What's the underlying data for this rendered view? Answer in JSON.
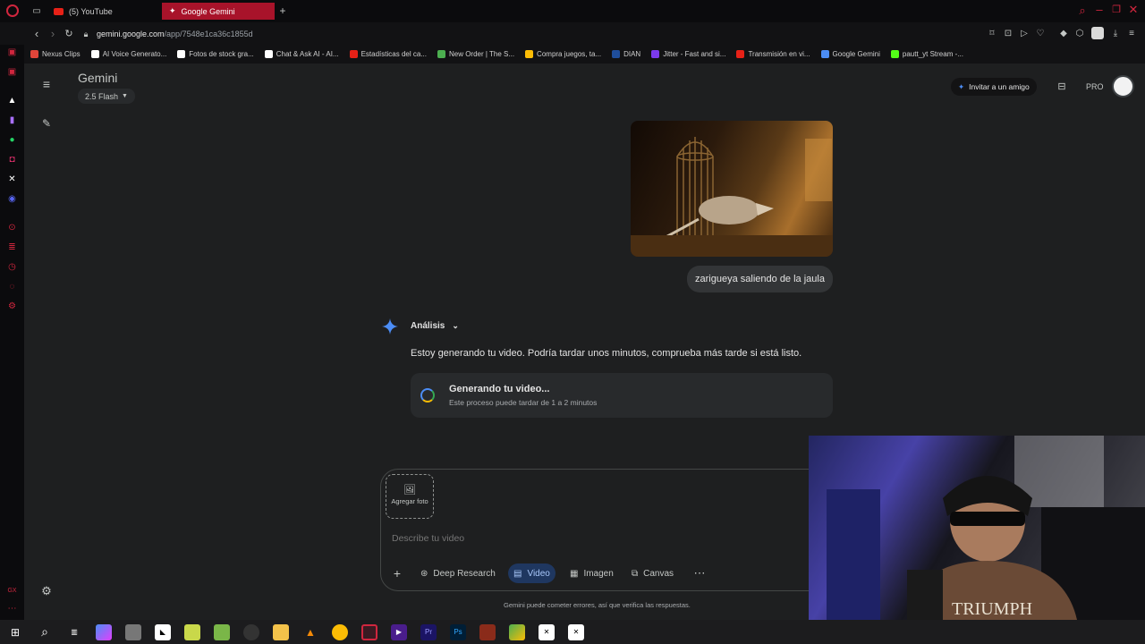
{
  "browser": {
    "tabs": [
      {
        "title": "(5) YouTube",
        "icon": "youtube-icon"
      },
      {
        "title": "Google Gemini",
        "icon": "gemini-icon"
      }
    ],
    "url_host": "gemini.google.com",
    "url_path": "/app/7548e1ca36c1855d",
    "bookmarks": [
      {
        "label": "Nexus Clips",
        "color": "#e0453a"
      },
      {
        "label": "AI Voice Generato...",
        "color": "#ffffff"
      },
      {
        "label": "Fotos de stock gra...",
        "color": "#ffffff"
      },
      {
        "label": "Chat & Ask AI - AI...",
        "color": "#ffffff"
      },
      {
        "label": "Estadísticas del ca...",
        "color": "#e62117"
      },
      {
        "label": "New Order | The S...",
        "color": "#4caf50"
      },
      {
        "label": "Compra juegos, ta...",
        "color": "#fbbc05"
      },
      {
        "label": "DIAN",
        "color": "#1f4e9b"
      },
      {
        "label": "Jitter - Fast and si...",
        "color": "#7c3aed"
      },
      {
        "label": "Transmisión en vi...",
        "color": "#e62117"
      },
      {
        "label": "Google Gemini",
        "color": "#4c8df6"
      },
      {
        "label": "pautt_yt Stream -...",
        "color": "#53fc18"
      }
    ]
  },
  "header": {
    "app_title": "Gemini",
    "model": "2.5 Flash",
    "invite": "Invitar a un amigo",
    "plan": "PRO"
  },
  "conversation": {
    "user_prompt": "zarigueya saliendo de la jaula",
    "analysis_label": "Análisis",
    "response_text": "Estoy generando tu video. Podría tardar unos minutos, comprueba más tarde si está listo.",
    "progress_title": "Generando tu video...",
    "progress_subtitle": "Este proceso puede tardar de 1 a 2 minutos"
  },
  "composer": {
    "add_photo": "Agregar foto",
    "placeholder": "Describe tu video",
    "tools": [
      "Deep Research",
      "Video",
      "Imagen",
      "Canvas"
    ],
    "active_tool": "Video",
    "disclaimer": "Gemini puede cometer errores, así que verifica las respuestas."
  },
  "colors": {
    "accent": "#a8c7fa",
    "opera_red": "#d0263e",
    "gemini_blue": "#4c8df6"
  },
  "webcam": {
    "shirt_text": "TRIUMPH"
  }
}
